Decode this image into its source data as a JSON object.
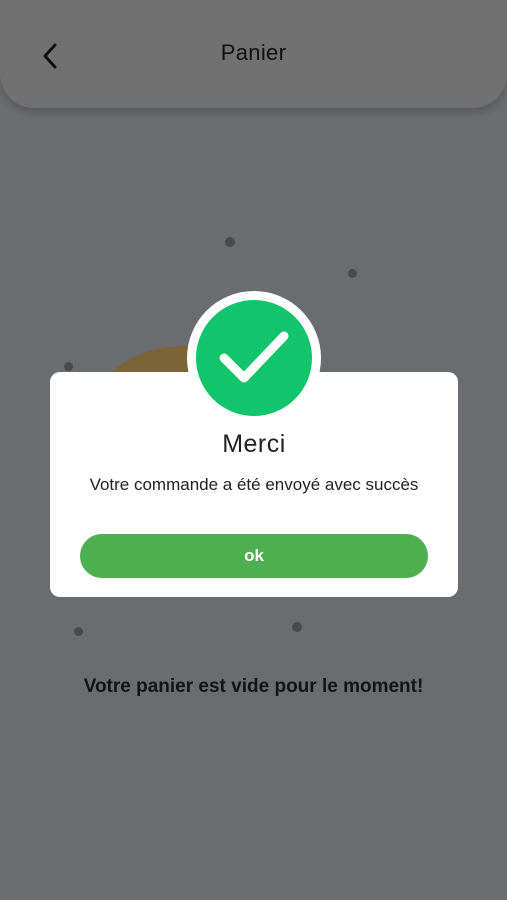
{
  "header": {
    "title": "Panier",
    "back_icon": "chevron-left-icon"
  },
  "page": {
    "empty_message": "Votre panier est vide pour le moment!"
  },
  "dialog": {
    "icon": "check-circle-icon",
    "title": "Merci",
    "message": "Votre commande a été envoyé avec succès",
    "ok_label": "ok"
  },
  "colors": {
    "overlay_background": "#6b6c70",
    "success_green": "#12c46b",
    "button_green": "#4caf50",
    "dialog_background": "#ffffff"
  }
}
